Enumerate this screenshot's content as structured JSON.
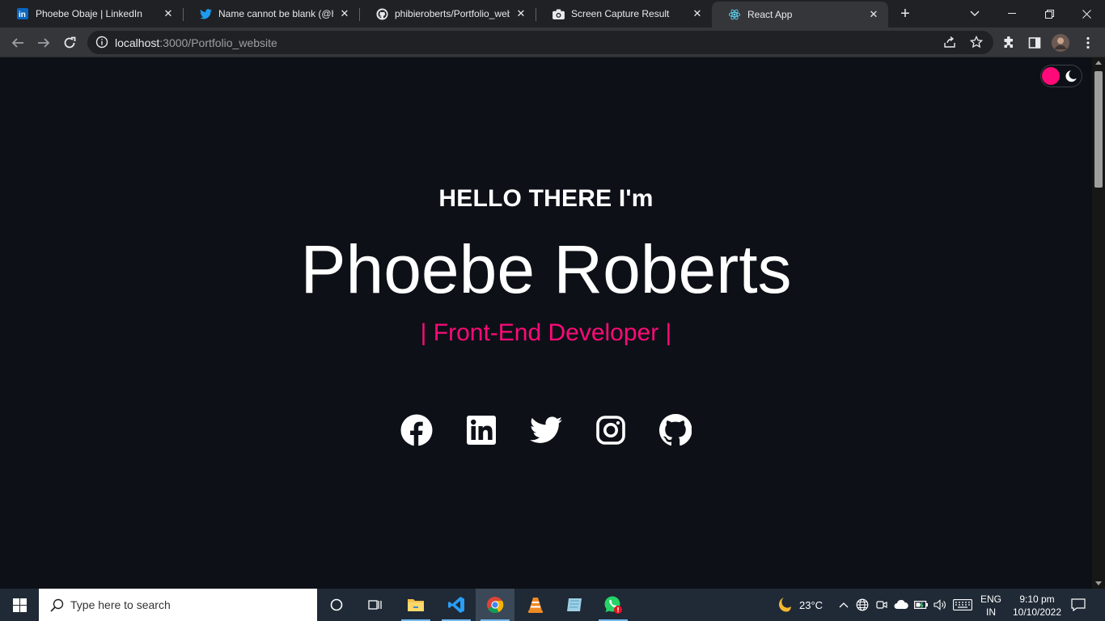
{
  "browser": {
    "tabs": [
      {
        "title": "Phoebe Obaje | LinkedIn",
        "favicon": "linkedin-icon",
        "active": false
      },
      {
        "title": "Name cannot be blank (@hac",
        "favicon": "twitter-icon",
        "active": false
      },
      {
        "title": "phibieroberts/Portfolio_webs",
        "favicon": "github-icon",
        "active": false
      },
      {
        "title": "Screen Capture Result",
        "favicon": "camera-icon",
        "active": false
      },
      {
        "title": "React App",
        "favicon": "react-icon",
        "active": true
      }
    ],
    "url_host": "localhost",
    "url_rest": ":3000/Portfolio_website"
  },
  "page": {
    "greeting": "HELLO THERE I'm",
    "name": "Phoebe Roberts",
    "role": "| Front-End Developer |",
    "socials": [
      "facebook-icon",
      "linkedin-icon",
      "twitter-icon",
      "instagram-icon",
      "github-icon"
    ],
    "accent_color": "#ff0a78",
    "background_color": "#0d1117"
  },
  "taskbar": {
    "search_placeholder": "Type here to search",
    "weather": "23°C",
    "lang_top": "ENG",
    "lang_bottom": "IN",
    "time": "9:10 pm",
    "date": "10/10/2022"
  }
}
